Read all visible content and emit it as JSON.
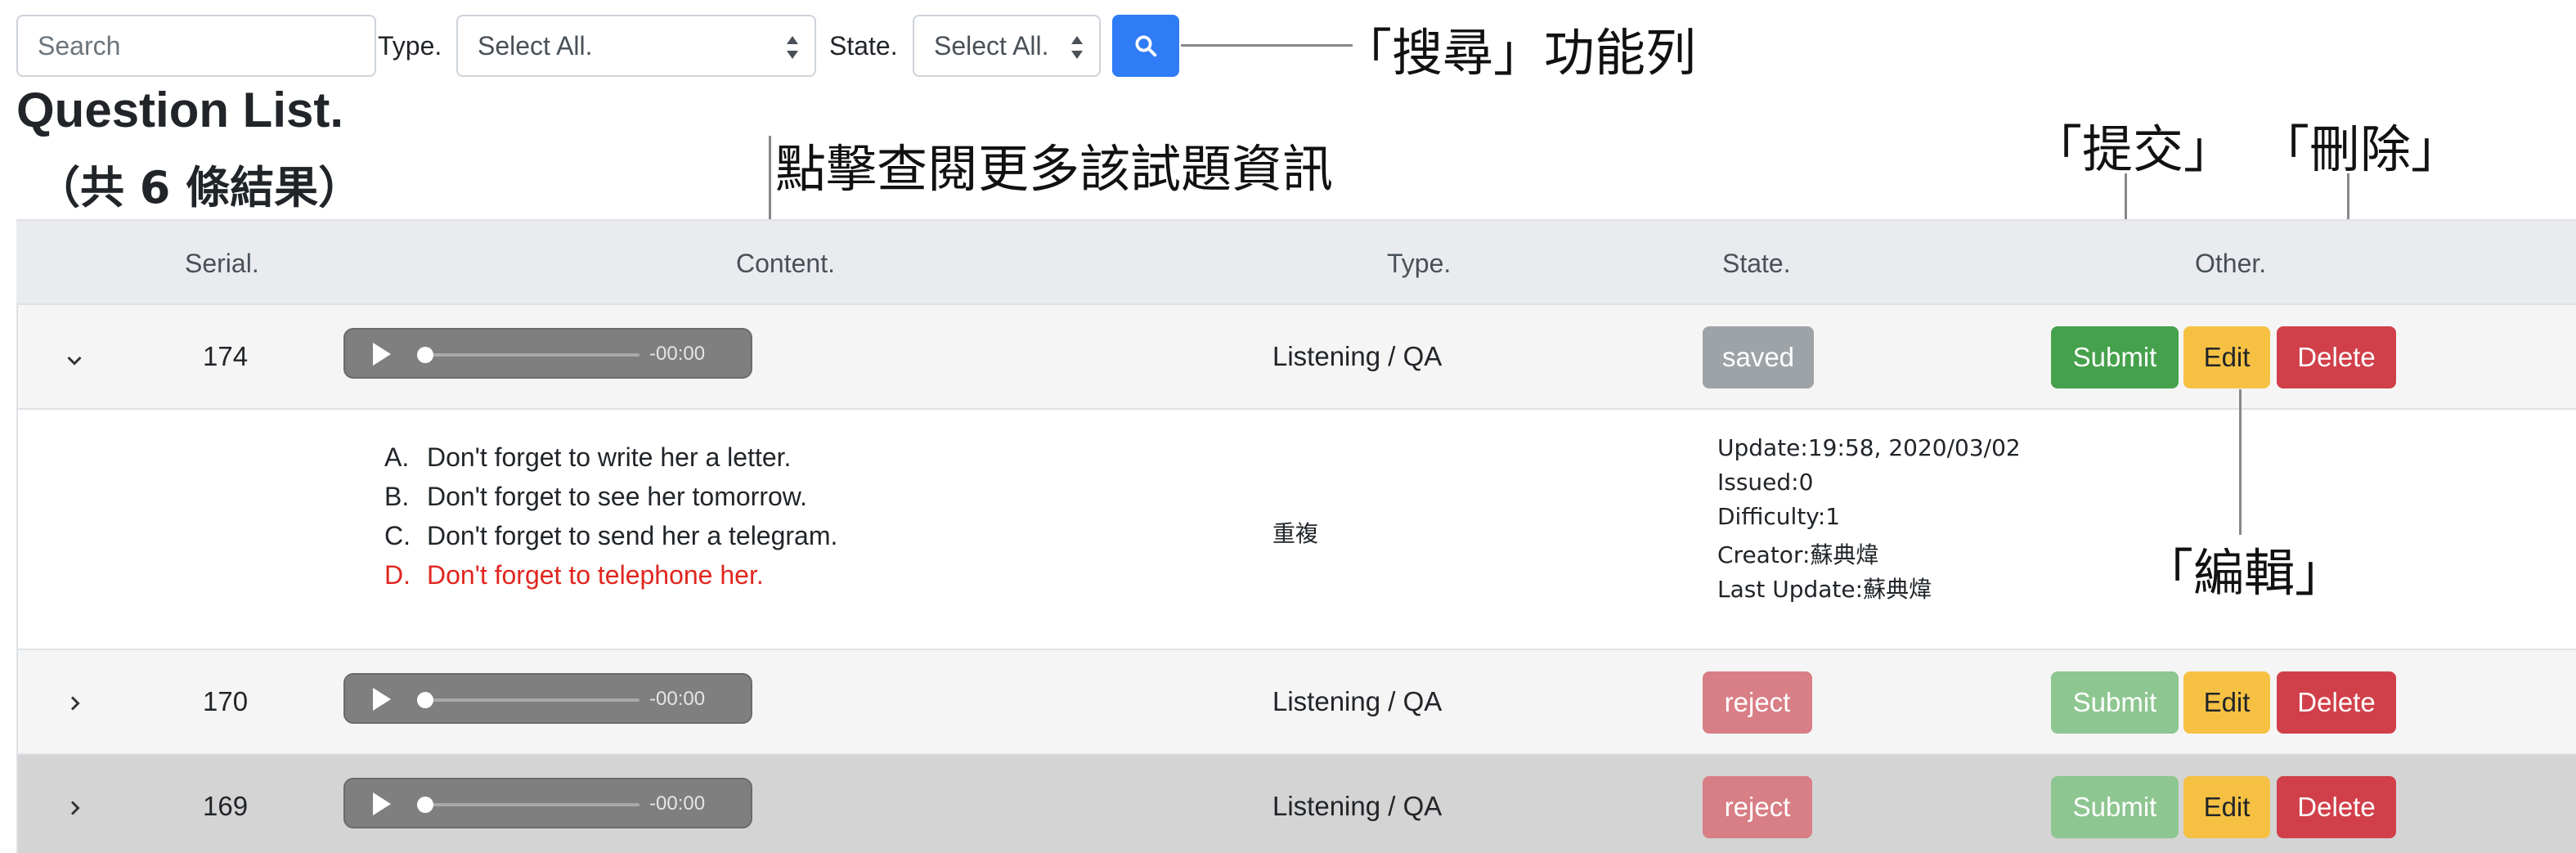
{
  "search": {
    "placeholder": "Search"
  },
  "filters": {
    "type_label": "Type.",
    "type_value": "Select All.",
    "state_label": "State.",
    "state_value": "Select All."
  },
  "annotations": {
    "search_bar": "「搜尋」功能列",
    "view_more": "點擊查閱更多該試題資訊",
    "submit": "「提交」",
    "delete": "「刪除」",
    "edit": "「編輯」"
  },
  "list": {
    "title": "Question List.",
    "result_count": "（共 6 條結果）"
  },
  "table": {
    "headers": {
      "serial": "Serial.",
      "content": "Content.",
      "type": "Type.",
      "state": "State.",
      "other": "Other."
    },
    "buttons": {
      "submit": "Submit",
      "edit": "Edit",
      "delete": "Delete"
    },
    "audio_time": "-00:00",
    "rows": [
      {
        "serial": "174",
        "type": "Listening / QA",
        "state": "saved",
        "expanded": true
      },
      {
        "serial": "170",
        "type": "Listening / QA",
        "state": "reject",
        "expanded": false
      },
      {
        "serial": "169",
        "type": "Listening / QA",
        "state": "reject",
        "expanded": false
      }
    ],
    "detail": {
      "options": [
        {
          "letter": "A.",
          "text": "Don't forget to write her a letter."
        },
        {
          "letter": "B.",
          "text": "Don't forget to see her tomorrow."
        },
        {
          "letter": "C.",
          "text": "Don't forget to send her a telegram."
        },
        {
          "letter": "D.",
          "text": "Don't forget to telephone her."
        }
      ],
      "correct_option": "D.",
      "tag": "重複",
      "meta": {
        "update": "Update:19:58, 2020/03/02",
        "issued": "Issued:0",
        "difficulty": "Difficulty:1",
        "creator": "Creator:蘇典煒",
        "last_update": "Last Update:蘇典煒"
      }
    }
  },
  "colors": {
    "primary": "#2f7cf6",
    "submit": "#45a14c",
    "edit": "#f6c143",
    "delete": "#d1404a",
    "saved_badge": "#9ea3a8",
    "reject_badge": "#d87e85",
    "correct_answer": "#e0261f"
  }
}
